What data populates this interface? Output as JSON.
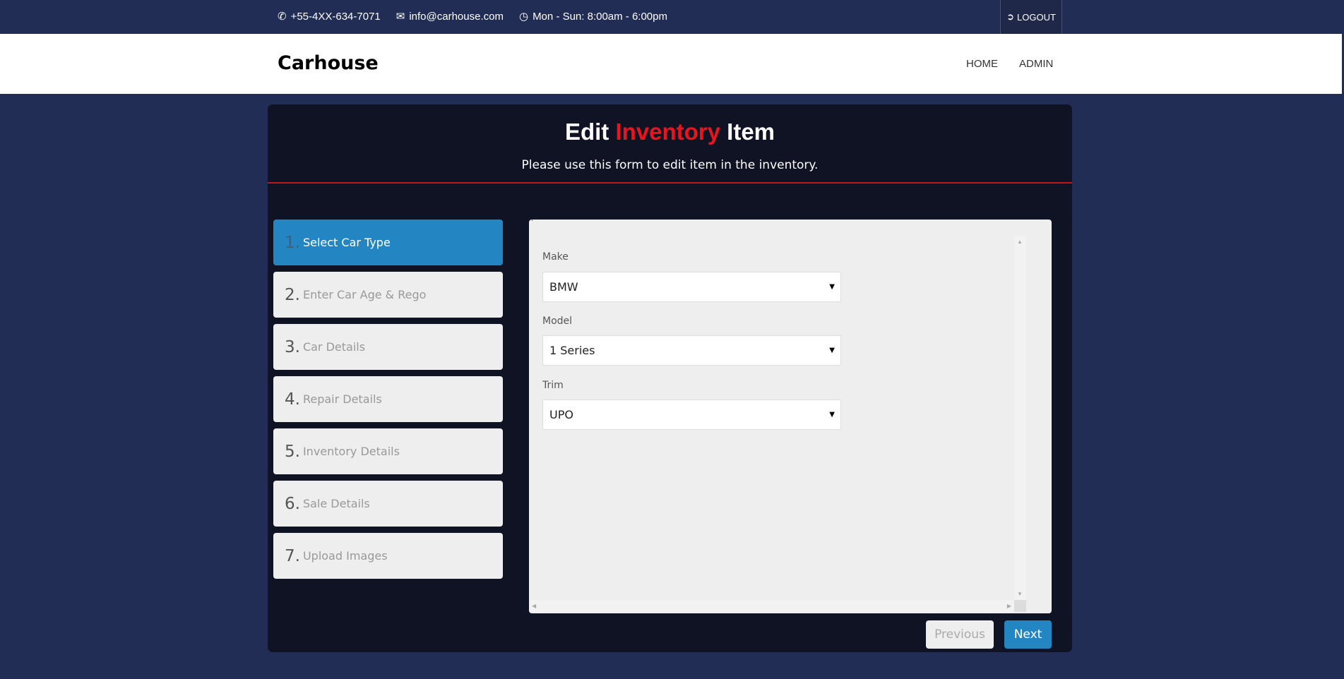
{
  "topbar": {
    "phone": "+55-4XX-634-7071",
    "email": "info@carhouse.com",
    "hours": "Mon - Sun: 8:00am - 6:00pm",
    "logout": "LOGOUT"
  },
  "header": {
    "brand": "Carhouse",
    "nav": [
      "HOME",
      "ADMIN"
    ]
  },
  "page": {
    "title_pre": "Edit",
    "title_accent": "Inventory",
    "title_post": "Item",
    "subtitle": "Please use this form to edit item in the inventory."
  },
  "steps": [
    {
      "num": "1.",
      "label": "Select Car Type"
    },
    {
      "num": "2.",
      "label": "Enter Car Age & Rego"
    },
    {
      "num": "3.",
      "label": "Car Details"
    },
    {
      "num": "4.",
      "label": "Repair Details"
    },
    {
      "num": "5.",
      "label": "Inventory Details"
    },
    {
      "num": "6.",
      "label": "Sale Details"
    },
    {
      "num": "7.",
      "label": "Upload Images"
    }
  ],
  "form": {
    "make_label": "Make",
    "make": "BMW",
    "model_label": "Model",
    "model": "1 Series",
    "trim_label": "Trim",
    "trim": "UPO",
    "stray": "`"
  },
  "buttons": {
    "previous": "Previous",
    "next": "Next"
  },
  "colors": {
    "accent": "#2385c2",
    "red": "#e8141f",
    "bg": "#222d55",
    "panel": "#0f1324"
  }
}
